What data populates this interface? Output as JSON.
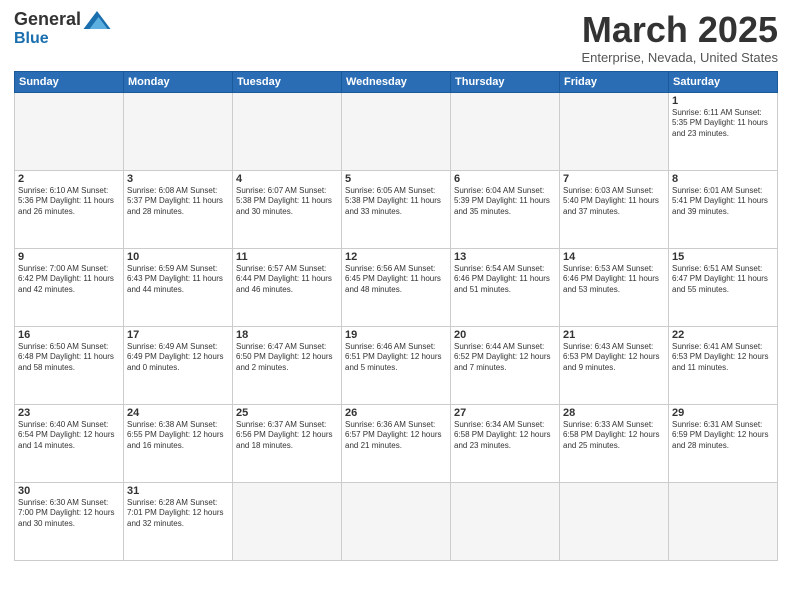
{
  "logo": {
    "general": "General",
    "blue": "Blue"
  },
  "header": {
    "title": "March 2025",
    "subtitle": "Enterprise, Nevada, United States"
  },
  "weekdays": [
    "Sunday",
    "Monday",
    "Tuesday",
    "Wednesday",
    "Thursday",
    "Friday",
    "Saturday"
  ],
  "weeks": [
    [
      {
        "day": "",
        "info": ""
      },
      {
        "day": "",
        "info": ""
      },
      {
        "day": "",
        "info": ""
      },
      {
        "day": "",
        "info": ""
      },
      {
        "day": "",
        "info": ""
      },
      {
        "day": "",
        "info": ""
      },
      {
        "day": "1",
        "info": "Sunrise: 6:11 AM\nSunset: 5:35 PM\nDaylight: 11 hours and 23 minutes."
      }
    ],
    [
      {
        "day": "2",
        "info": "Sunrise: 6:10 AM\nSunset: 5:36 PM\nDaylight: 11 hours and 26 minutes."
      },
      {
        "day": "3",
        "info": "Sunrise: 6:08 AM\nSunset: 5:37 PM\nDaylight: 11 hours and 28 minutes."
      },
      {
        "day": "4",
        "info": "Sunrise: 6:07 AM\nSunset: 5:38 PM\nDaylight: 11 hours and 30 minutes."
      },
      {
        "day": "5",
        "info": "Sunrise: 6:05 AM\nSunset: 5:38 PM\nDaylight: 11 hours and 33 minutes."
      },
      {
        "day": "6",
        "info": "Sunrise: 6:04 AM\nSunset: 5:39 PM\nDaylight: 11 hours and 35 minutes."
      },
      {
        "day": "7",
        "info": "Sunrise: 6:03 AM\nSunset: 5:40 PM\nDaylight: 11 hours and 37 minutes."
      },
      {
        "day": "8",
        "info": "Sunrise: 6:01 AM\nSunset: 5:41 PM\nDaylight: 11 hours and 39 minutes."
      }
    ],
    [
      {
        "day": "9",
        "info": "Sunrise: 7:00 AM\nSunset: 6:42 PM\nDaylight: 11 hours and 42 minutes."
      },
      {
        "day": "10",
        "info": "Sunrise: 6:59 AM\nSunset: 6:43 PM\nDaylight: 11 hours and 44 minutes."
      },
      {
        "day": "11",
        "info": "Sunrise: 6:57 AM\nSunset: 6:44 PM\nDaylight: 11 hours and 46 minutes."
      },
      {
        "day": "12",
        "info": "Sunrise: 6:56 AM\nSunset: 6:45 PM\nDaylight: 11 hours and 48 minutes."
      },
      {
        "day": "13",
        "info": "Sunrise: 6:54 AM\nSunset: 6:46 PM\nDaylight: 11 hours and 51 minutes."
      },
      {
        "day": "14",
        "info": "Sunrise: 6:53 AM\nSunset: 6:46 PM\nDaylight: 11 hours and 53 minutes."
      },
      {
        "day": "15",
        "info": "Sunrise: 6:51 AM\nSunset: 6:47 PM\nDaylight: 11 hours and 55 minutes."
      }
    ],
    [
      {
        "day": "16",
        "info": "Sunrise: 6:50 AM\nSunset: 6:48 PM\nDaylight: 11 hours and 58 minutes."
      },
      {
        "day": "17",
        "info": "Sunrise: 6:49 AM\nSunset: 6:49 PM\nDaylight: 12 hours and 0 minutes."
      },
      {
        "day": "18",
        "info": "Sunrise: 6:47 AM\nSunset: 6:50 PM\nDaylight: 12 hours and 2 minutes."
      },
      {
        "day": "19",
        "info": "Sunrise: 6:46 AM\nSunset: 6:51 PM\nDaylight: 12 hours and 5 minutes."
      },
      {
        "day": "20",
        "info": "Sunrise: 6:44 AM\nSunset: 6:52 PM\nDaylight: 12 hours and 7 minutes."
      },
      {
        "day": "21",
        "info": "Sunrise: 6:43 AM\nSunset: 6:53 PM\nDaylight: 12 hours and 9 minutes."
      },
      {
        "day": "22",
        "info": "Sunrise: 6:41 AM\nSunset: 6:53 PM\nDaylight: 12 hours and 11 minutes."
      }
    ],
    [
      {
        "day": "23",
        "info": "Sunrise: 6:40 AM\nSunset: 6:54 PM\nDaylight: 12 hours and 14 minutes."
      },
      {
        "day": "24",
        "info": "Sunrise: 6:38 AM\nSunset: 6:55 PM\nDaylight: 12 hours and 16 minutes."
      },
      {
        "day": "25",
        "info": "Sunrise: 6:37 AM\nSunset: 6:56 PM\nDaylight: 12 hours and 18 minutes."
      },
      {
        "day": "26",
        "info": "Sunrise: 6:36 AM\nSunset: 6:57 PM\nDaylight: 12 hours and 21 minutes."
      },
      {
        "day": "27",
        "info": "Sunrise: 6:34 AM\nSunset: 6:58 PM\nDaylight: 12 hours and 23 minutes."
      },
      {
        "day": "28",
        "info": "Sunrise: 6:33 AM\nSunset: 6:58 PM\nDaylight: 12 hours and 25 minutes."
      },
      {
        "day": "29",
        "info": "Sunrise: 6:31 AM\nSunset: 6:59 PM\nDaylight: 12 hours and 28 minutes."
      }
    ],
    [
      {
        "day": "30",
        "info": "Sunrise: 6:30 AM\nSunset: 7:00 PM\nDaylight: 12 hours and 30 minutes."
      },
      {
        "day": "31",
        "info": "Sunrise: 6:28 AM\nSunset: 7:01 PM\nDaylight: 12 hours and 32 minutes."
      },
      {
        "day": "",
        "info": ""
      },
      {
        "day": "",
        "info": ""
      },
      {
        "day": "",
        "info": ""
      },
      {
        "day": "",
        "info": ""
      },
      {
        "day": "",
        "info": ""
      }
    ]
  ]
}
